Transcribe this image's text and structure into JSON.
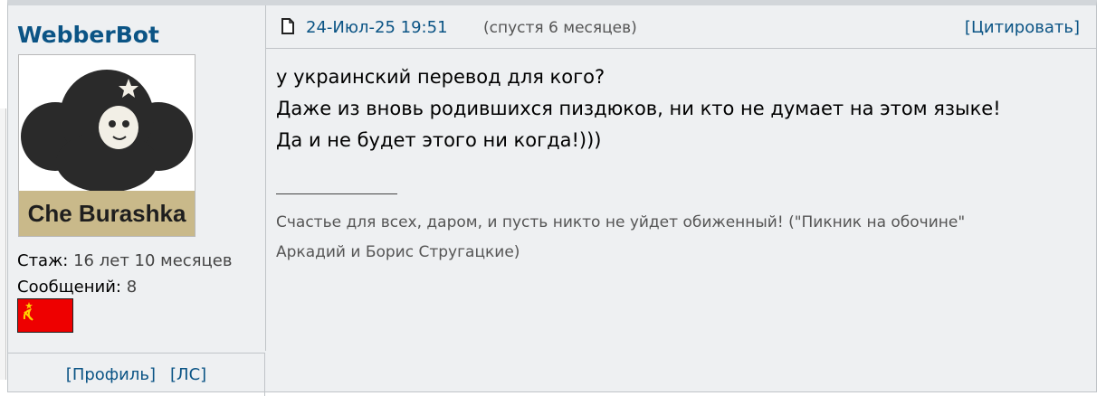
{
  "author": {
    "name": "WebberBot",
    "avatar_caption": "Che Burashka",
    "stats": [
      {
        "label": "Стаж:",
        "value": "16 лет 10 месяцев"
      },
      {
        "label": "Сообщений:",
        "value": "8"
      }
    ],
    "flag_icon": "ussr-flag-icon",
    "flag_colors": {
      "field": "#ee0000",
      "emblem": "#ffd200"
    },
    "links": [
      "[Профиль]",
      "[ЛС]"
    ]
  },
  "post": {
    "icon": "post-document-icon",
    "date": "24-Июл-25 19:51",
    "ago": "(спустя 6 месяцев)",
    "quote_label": "[Цитировать]",
    "body_lines": [
      "у украинский перевод для кого?",
      "Даже из вновь родившихся пиздюков, ни кто не думает на этом языке!",
      "Да и не будет этого ни когда!)))"
    ],
    "signature_lines": [
      "Счастье для всех, даром, и пусть никто не уйдет обиженный! (\"Пикник на обочине\"",
      "Аркадий и Борис Стругацкие)"
    ]
  },
  "colors": {
    "accent": "#0b5485",
    "panel_bg": "#eef0f2",
    "border": "#c0c4c8"
  }
}
